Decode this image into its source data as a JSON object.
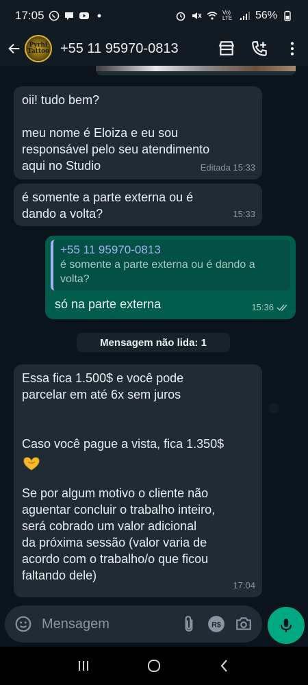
{
  "status_bar": {
    "time": "17:05",
    "battery": "56%",
    "network": "Vo) LTE"
  },
  "header": {
    "avatar_text": "Pyrhi Tattoo",
    "contact": "+55 11 95970-0813"
  },
  "messages": [
    {
      "direction": "in",
      "text": "oii! tudo bem?\n\nmeu nome é Eloiza e eu sou\nresponsável pelo seu atendimento\naqui no Studio",
      "meta": "Editada 15:33"
    },
    {
      "direction": "in",
      "text": "é somente a parte externa ou é\ndando a volta?",
      "meta": "15:33"
    },
    {
      "direction": "out",
      "quote_author": "+55 11 95970-0813",
      "quote_text": "é somente a parte externa ou é dando a\nvolta?",
      "text": "só na parte externa",
      "meta": "15:36"
    },
    {
      "direction": "in",
      "text_a": "Essa fica 1.500$ e você pode\nparcelar em até 6x sem juros\n\n\nCaso você pague a vista, fica 1.350$",
      "emoji": "heart-hands",
      "text_b": "Se por algum motivo o cliente não\naguentar concluir o trabalho inteiro,\nserá cobrado um valor adicional\nda próxima sessão (valor varia de\nacordo com o trabalho/o que ficou\nfaltando dele)",
      "meta": "17:04"
    }
  ],
  "unread_label": "Mensagem não lida: 1",
  "input": {
    "placeholder": "Mensagem"
  },
  "icons": {
    "status": [
      "whatsapp-icon",
      "chat-icon",
      "youtube-icon",
      "dot-icon",
      "alarm-icon",
      "mute-icon",
      "wifi-icon",
      "signal-icon",
      "battery-icon"
    ],
    "header": [
      "back-arrow-icon",
      "store-icon",
      "add-call-icon",
      "more-vert-icon"
    ],
    "input": [
      "emoji-icon",
      "attach-icon",
      "payment-icon",
      "camera-icon",
      "mic-icon"
    ],
    "nav": [
      "recent-apps-icon",
      "home-icon",
      "back-icon"
    ]
  },
  "colors": {
    "background": "#0b141a",
    "incoming_bubble": "#202c33",
    "outgoing_bubble": "#005c4b",
    "accent": "#00a884",
    "quote_author": "#a5b1f0"
  }
}
